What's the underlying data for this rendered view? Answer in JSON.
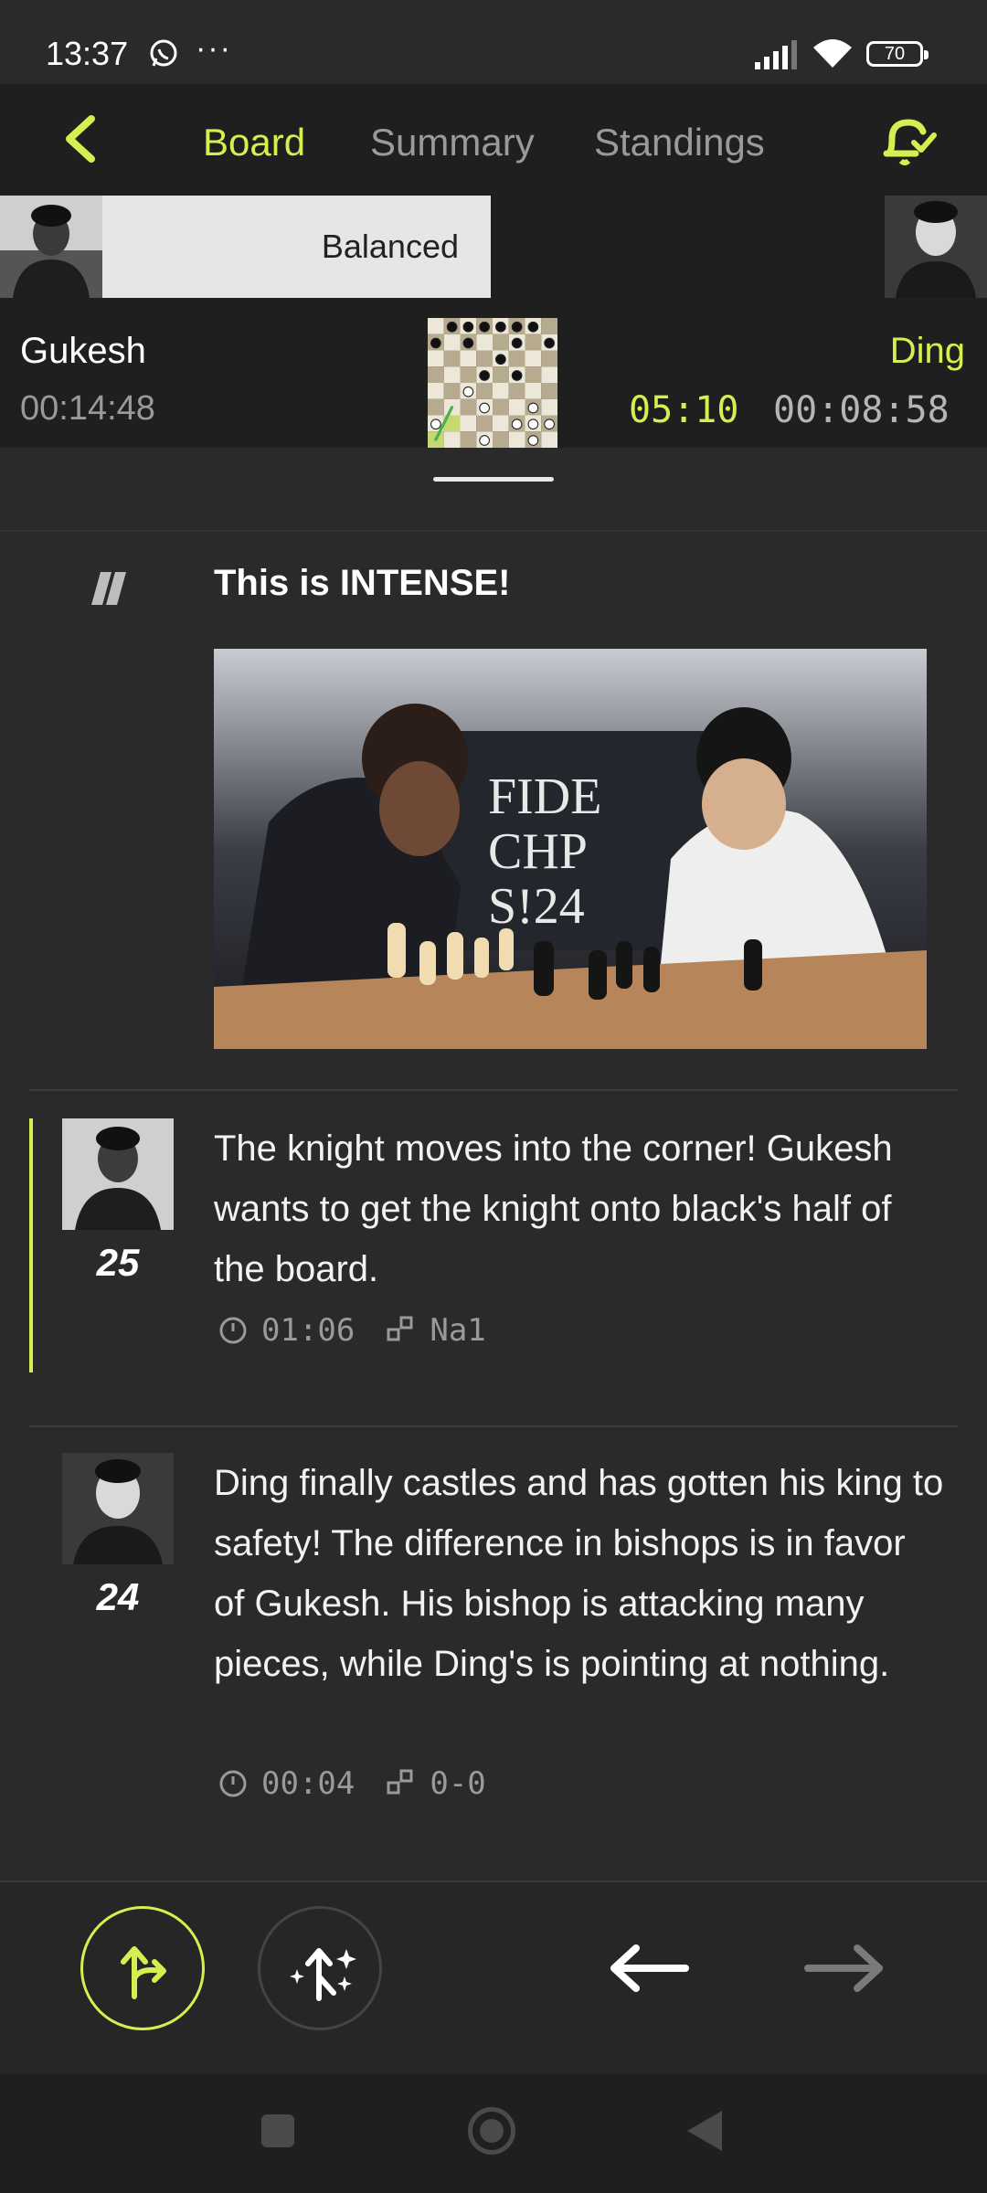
{
  "status_bar": {
    "time": "13:37",
    "dots": "···",
    "battery": "70",
    "icons": [
      "whatsapp-icon",
      "signal-icon",
      "wifi-icon",
      "battery-icon"
    ]
  },
  "nav": {
    "tabs": [
      {
        "label": "Board",
        "active": true
      },
      {
        "label": "Summary",
        "active": false
      },
      {
        "label": "Standings",
        "active": false
      }
    ],
    "icons": [
      "back-chevron-icon",
      "notification-bell-check-icon"
    ]
  },
  "evaluation": {
    "label": "Balanced",
    "white_share": 0.5
  },
  "players": {
    "left": {
      "name": "Gukesh",
      "clock": "00:14:48"
    },
    "right": {
      "name": "Ding",
      "move_clock": "05:10",
      "clock": "00:08:58"
    }
  },
  "feed": {
    "highlight": {
      "title": "This is INTENSE!",
      "icon": "quote-icon",
      "image": "photo of the two players at the board"
    },
    "comments": [
      {
        "move": "25",
        "text": "The knight moves into the corner! Gukesh wants to get the knight onto black's half of the board.",
        "time": "01:06",
        "notation": "Na1",
        "selected": true
      },
      {
        "move": "24",
        "text": "Ding finally castles and has gotten his king to safety! The difference in bishops is in favor of Gukesh. His bishop is attacking many pieces, while Ding's is pointing at nothing.",
        "time": "00:04",
        "notation": "0-0",
        "selected": false
      }
    ]
  },
  "toolbar": {
    "icons": [
      "variations-icon",
      "engine-sparkle-icon",
      "arrow-left-icon",
      "arrow-right-icon"
    ]
  },
  "colors": {
    "accent": "#d4f050",
    "background": "#2a2a2a",
    "bar": "#1f1f1f"
  }
}
